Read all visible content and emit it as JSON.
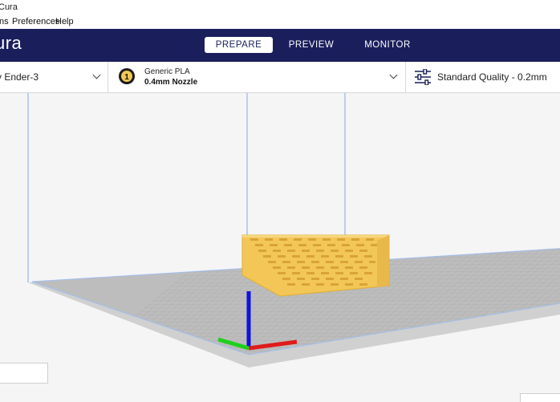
{
  "window": {
    "title": "Cura"
  },
  "menu": {
    "items": [
      "ns",
      "Preferences",
      "Help"
    ]
  },
  "header": {
    "logo": "ura",
    "tabs": [
      {
        "label": "PREPARE",
        "active": true
      },
      {
        "label": "PREVIEW",
        "active": false
      },
      {
        "label": "MONITOR",
        "active": false
      }
    ]
  },
  "toolbar": {
    "printer": "y Ender-3",
    "material": {
      "badge": "1",
      "name": "Generic PLA",
      "nozzle": "0.4mm Nozzle"
    },
    "quality": "Standard Quality - 0.2mm"
  },
  "colors": {
    "header_bg": "#1a1f5c",
    "model": "#f3c757",
    "axis_x": "#e01b1b",
    "axis_y": "#1fcf1f",
    "axis_z": "#1010e0",
    "bed_grid": "#9a9a9a"
  },
  "icons": {
    "material_badge": "spool-badge-icon",
    "quality": "settings-sliders-icon",
    "dropdown": "chevron-down-icon"
  }
}
